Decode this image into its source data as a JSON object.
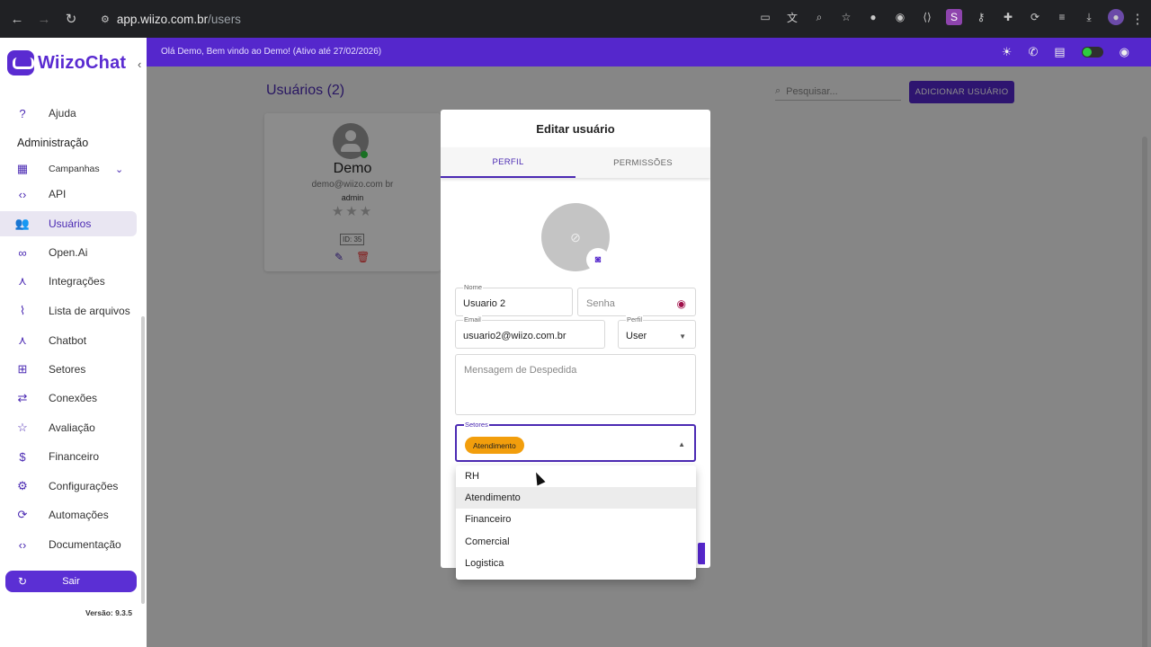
{
  "browser": {
    "url_host": "app.wiizo.com.br",
    "url_path": "/users"
  },
  "app": {
    "brand": "WiizoChat",
    "greeting": "Olá Demo, Bem vindo ao Demo! (Ativo até 27/02/2026)"
  },
  "sidebar": {
    "help": "Ajuda",
    "section_title": "Administração",
    "items": [
      {
        "label": "Campanhas"
      },
      {
        "label": "API"
      },
      {
        "label": "Usuários"
      },
      {
        "label": "Open.Ai"
      },
      {
        "label": "Integrações"
      },
      {
        "label": "Lista de arquivos"
      },
      {
        "label": "Chatbot"
      },
      {
        "label": "Setores"
      },
      {
        "label": "Conexões"
      },
      {
        "label": "Avaliação"
      },
      {
        "label": "Financeiro"
      },
      {
        "label": "Configurações"
      },
      {
        "label": "Automações"
      },
      {
        "label": "Documentação"
      }
    ],
    "logout": "Sair",
    "version": "Versão: 9.3.5"
  },
  "main": {
    "title": "Usuários (2)",
    "search_placeholder": "Pesquisar...",
    "add_button": "ADICIONAR USUÁRIO",
    "card": {
      "name": "Demo",
      "email": "demo@wiizo.com br",
      "role": "admin",
      "stars": "★★★",
      "id": "ID: 35"
    }
  },
  "modal": {
    "title": "Editar usuário",
    "tabs": [
      "PERFIL",
      "PERMISSÕES"
    ],
    "fields": {
      "name_label": "Nome",
      "name_value": "Usuario 2",
      "password_placeholder": "Senha",
      "email_label": "Email",
      "email_value": "usuario2@wiizo.com.br",
      "profile_label": "Perfil",
      "profile_value": "User",
      "farewell_placeholder": "Mensagem de Despedida",
      "sectors_label": "Setores",
      "sectors_chip": "Atendimento"
    }
  },
  "dropdown": {
    "options": [
      "RH",
      "Atendimento",
      "Financeiro",
      "Comercial",
      "Logistica"
    ],
    "selected": "Atendimento"
  },
  "colors": {
    "primary": "#5527cc",
    "chip": "#f29e0c",
    "online": "#2ecc40"
  }
}
